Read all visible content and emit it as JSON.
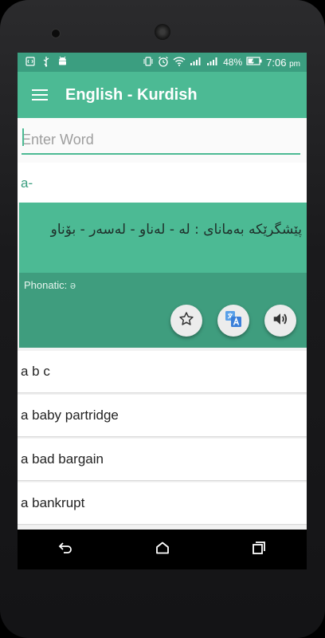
{
  "status_bar": {
    "battery": "48%",
    "time": "7:06",
    "ampm": "pm"
  },
  "app_bar": {
    "title": "English - Kurdish"
  },
  "search": {
    "placeholder": "Enter Word",
    "value": ""
  },
  "selected_word": {
    "word": "a-",
    "definition": "پێشگرێکە بەمانای : لە - لەناو - لەسەر - بۆناو",
    "phonetic_label": "Phonatic:",
    "phonetic_value": "ə",
    "actions": [
      {
        "icon": "star-icon"
      },
      {
        "icon": "translate-icon"
      },
      {
        "icon": "volume-icon"
      }
    ]
  },
  "word_list": [
    "a b c",
    "a baby partridge",
    "a bad bargain",
    "a bankrupt"
  ],
  "colors": {
    "status_bar": "#3b9e80",
    "app_bar": "#4cba94",
    "card": "#4cba94",
    "card_footer": "#3f9d7e"
  }
}
